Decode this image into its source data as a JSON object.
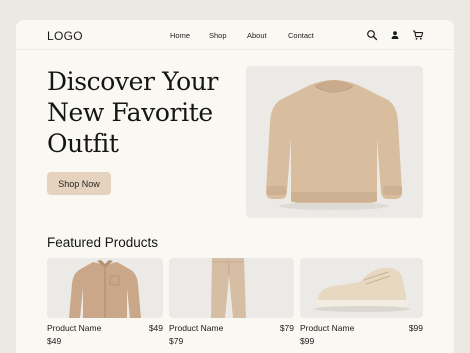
{
  "header": {
    "logo": "LOGO",
    "nav": [
      "Home",
      "Shop",
      "About",
      "Contact"
    ],
    "icons": [
      "search-icon",
      "user-icon",
      "cart-icon"
    ]
  },
  "hero": {
    "headline_lines": [
      "Discover Your",
      "New Favorite",
      "Outfit"
    ],
    "cta_label": "Shop Now",
    "image": "beige-sweater"
  },
  "featured": {
    "title": "Featured Products",
    "products": [
      {
        "name": "Product Name",
        "price": "$49",
        "price_repeat": "$49",
        "image": "beige-shirt"
      },
      {
        "name": "Product Name",
        "price": "$79",
        "price_repeat": "$79",
        "image": "beige-trousers"
      },
      {
        "name": "Product Name",
        "price": "$99",
        "price_repeat": "$99",
        "image": "beige-sneaker"
      }
    ]
  },
  "colors": {
    "page_bg": "#faf8f3",
    "cta_bg": "#e6d3bf",
    "product_tan": "#d4b89a"
  }
}
